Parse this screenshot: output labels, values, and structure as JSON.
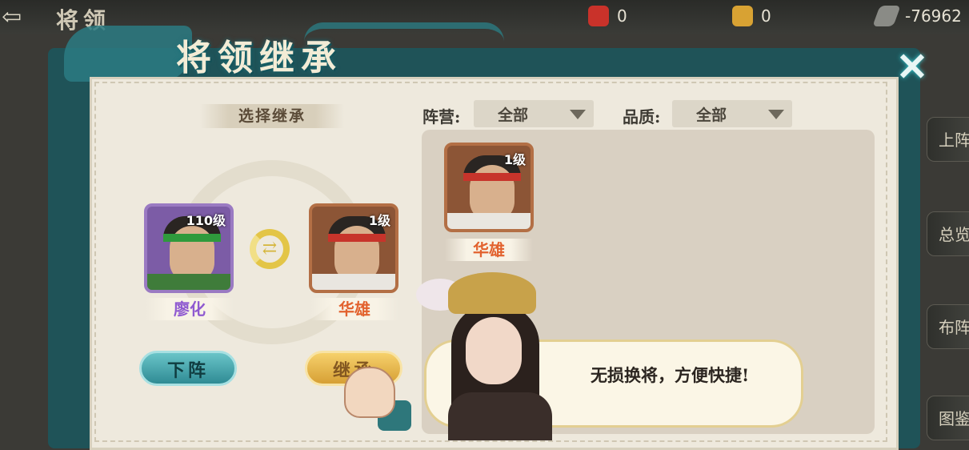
{
  "topbar": {
    "back_icon": "back-arrow-icon",
    "title": "将领",
    "resources": [
      {
        "icon": "red-token-icon",
        "value": "0"
      },
      {
        "icon": "gold-token-icon",
        "value": "0"
      },
      {
        "icon": "scroll-icon",
        "value": "-76962"
      }
    ]
  },
  "side_tabs": [
    "上阵",
    "总览",
    "布阵",
    "图鉴"
  ],
  "dialog": {
    "title": "将领继承",
    "close_icon": "close-icon",
    "left": {
      "header": "选择继承",
      "source": {
        "name": "廖化",
        "level": "110级",
        "name_color": "#8f5ad0"
      },
      "target": {
        "name": "华雄",
        "level": "1级",
        "name_color": "#e2622e"
      },
      "swap_icon": "swap-arrows-icon",
      "btn_down": "下阵",
      "btn_inherit": "继承"
    },
    "filters": {
      "camp_label": "阵营:",
      "camp_value": "全部",
      "quality_label": "品质:",
      "quality_value": "全部"
    },
    "list": [
      {
        "name": "华雄",
        "level": "1级",
        "name_color": "#e2622e"
      }
    ],
    "advisor": {
      "text": "无损换将，方便快捷!"
    }
  }
}
